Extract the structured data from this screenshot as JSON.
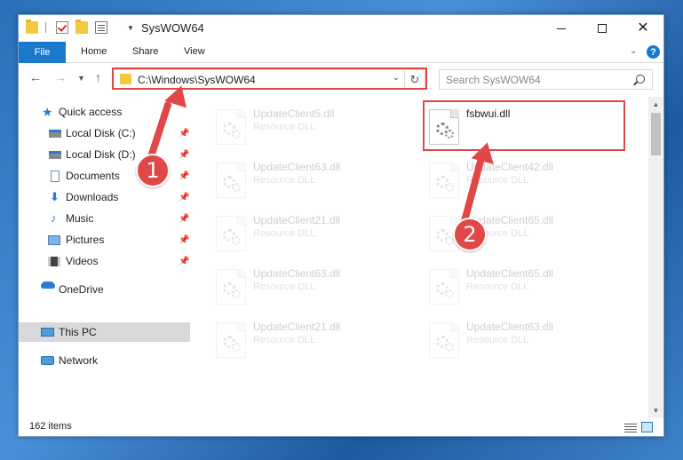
{
  "window": {
    "title": "SysWOW64",
    "buttons": {
      "minimize": "–",
      "maximize": "□",
      "close": "✕"
    }
  },
  "ribbon": {
    "tabs": [
      "File",
      "Home",
      "Share",
      "View"
    ],
    "help": "?"
  },
  "address": {
    "path": "C:\\Windows\\SysWOW64",
    "search_placeholder": "Search SysWOW64"
  },
  "nav": {
    "items": [
      {
        "label": "Quick access",
        "icon": "star-icon"
      },
      {
        "label": "Local Disk (C:)",
        "icon": "drive-icon",
        "pinned": true
      },
      {
        "label": "Local Disk (D:)",
        "icon": "drive-icon",
        "pinned": true
      },
      {
        "label": "Documents",
        "icon": "document-icon",
        "pinned": true
      },
      {
        "label": "Downloads",
        "icon": "download-icon",
        "pinned": true
      },
      {
        "label": "Music",
        "icon": "music-icon",
        "pinned": true
      },
      {
        "label": "Pictures",
        "icon": "pictures-icon",
        "pinned": true
      },
      {
        "label": "Videos",
        "icon": "videos-icon",
        "pinned": true
      },
      {
        "label": "OneDrive",
        "icon": "cloud-icon"
      },
      {
        "label": "This PC",
        "icon": "computer-icon",
        "selected": true
      },
      {
        "label": "Network",
        "icon": "network-icon"
      }
    ]
  },
  "files": [
    {
      "name": "UpdateClient5.dll",
      "type": "Resource DLL"
    },
    {
      "name": "fsbwui.dll",
      "type": ""
    },
    {
      "name": "UpdateClient63.dll",
      "type": "Resource DLL"
    },
    {
      "name": "UpdateClient42.dll",
      "type": "Resource DLL"
    },
    {
      "name": "UpdateClient21.dll",
      "type": "Resource DLL"
    },
    {
      "name": "UpdateClient65.dll",
      "type": "Resource DLL"
    },
    {
      "name": "UpdateClient63.dll",
      "type": "Resource DLL"
    },
    {
      "name": "UpdateClient65.dll",
      "type": "Resource DLL"
    },
    {
      "name": "UpdateClient21.dll",
      "type": "Resource DLL"
    },
    {
      "name": "UpdateClient63.dll",
      "type": "Resource DLL"
    }
  ],
  "status": {
    "items": "162 items"
  },
  "annotations": {
    "badge1": "1",
    "badge2": "2"
  },
  "colors": {
    "accent": "#1979ca",
    "highlight": "#e04848"
  }
}
